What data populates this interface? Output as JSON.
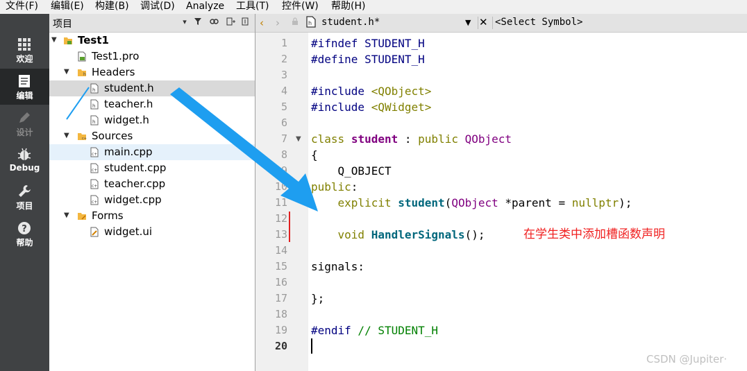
{
  "menu": [
    "文件(F)",
    "编辑(E)",
    "构建(B)",
    "调试(D)",
    "Analyze",
    "工具(T)",
    "控件(W)",
    "帮助(H)"
  ],
  "modes": [
    {
      "label": "欢迎",
      "icon": "grid-icon"
    },
    {
      "label": "编辑",
      "icon": "document-icon",
      "active": true
    },
    {
      "label": "设计",
      "icon": "pencil-icon",
      "disabled": true
    },
    {
      "label": "Debug",
      "icon": "bug-icon"
    },
    {
      "label": "项目",
      "icon": "wrench-icon"
    },
    {
      "label": "帮助",
      "icon": "help-icon"
    }
  ],
  "project_panel": {
    "title": "项目",
    "tree": [
      {
        "label": "Test1",
        "type": "project"
      },
      {
        "label": "Test1.pro",
        "type": "pro-file"
      },
      {
        "label": "Headers",
        "type": "folder"
      },
      {
        "label": "student.h",
        "type": "header",
        "selected": true
      },
      {
        "label": "teacher.h",
        "type": "header"
      },
      {
        "label": "widget.h",
        "type": "header"
      },
      {
        "label": "Sources",
        "type": "folder"
      },
      {
        "label": "main.cpp",
        "type": "source",
        "hovered": true
      },
      {
        "label": "student.cpp",
        "type": "source"
      },
      {
        "label": "teacher.cpp",
        "type": "source"
      },
      {
        "label": "widget.cpp",
        "type": "source"
      },
      {
        "label": "Forms",
        "type": "folder"
      },
      {
        "label": "widget.ui",
        "type": "ui-file"
      }
    ]
  },
  "editor": {
    "file_tab": "student.h*",
    "symbol_select": "<Select Symbol>",
    "line_numbers": [
      "1",
      "2",
      "3",
      "4",
      "5",
      "6",
      "7",
      "8",
      "9",
      "10",
      "11",
      "12",
      "13",
      "14",
      "15",
      "16",
      "17",
      "18",
      "19",
      "20"
    ],
    "current_line": "20",
    "lines": {
      "l1": {
        "a": "#ifndef",
        "b": " STUDENT_H"
      },
      "l2": {
        "a": "#define",
        "b": " STUDENT_H"
      },
      "l4": {
        "a": "#include",
        "b": " ",
        "c": "<QObject>"
      },
      "l5": {
        "a": "#include",
        "b": " ",
        "c": "<QWidget>"
      },
      "l7": {
        "a": "class",
        "b": " ",
        "c": "student",
        "d": " : ",
        "e": "public",
        "f": " ",
        "g": "QObject"
      },
      "l8": {
        "a": "{"
      },
      "l9": {
        "a": "    Q_OBJECT"
      },
      "l10": {
        "a": "public",
        "b": ":"
      },
      "l11": {
        "a": "    ",
        "b": "explicit",
        "c": " ",
        "d": "student",
        "e": "(",
        "f": "QObject",
        "g": " *parent = ",
        "h": "nullptr",
        "i": ");"
      },
      "l13": {
        "a": "    ",
        "b": "void",
        "c": " ",
        "d": "HandlerSignals",
        "e": "();"
      },
      "l15": {
        "a": "signals:"
      },
      "l17": {
        "a": "};"
      },
      "l19": {
        "a": "#endif",
        "b": " // STUDENT_H"
      }
    }
  },
  "annotation": "在学生类中添加槽函数声明",
  "watermark": "CSDN @Jupiter·",
  "colors": {
    "arrow": "#1e9ef0",
    "annotation": "#f02020",
    "modebar": "#404244"
  }
}
